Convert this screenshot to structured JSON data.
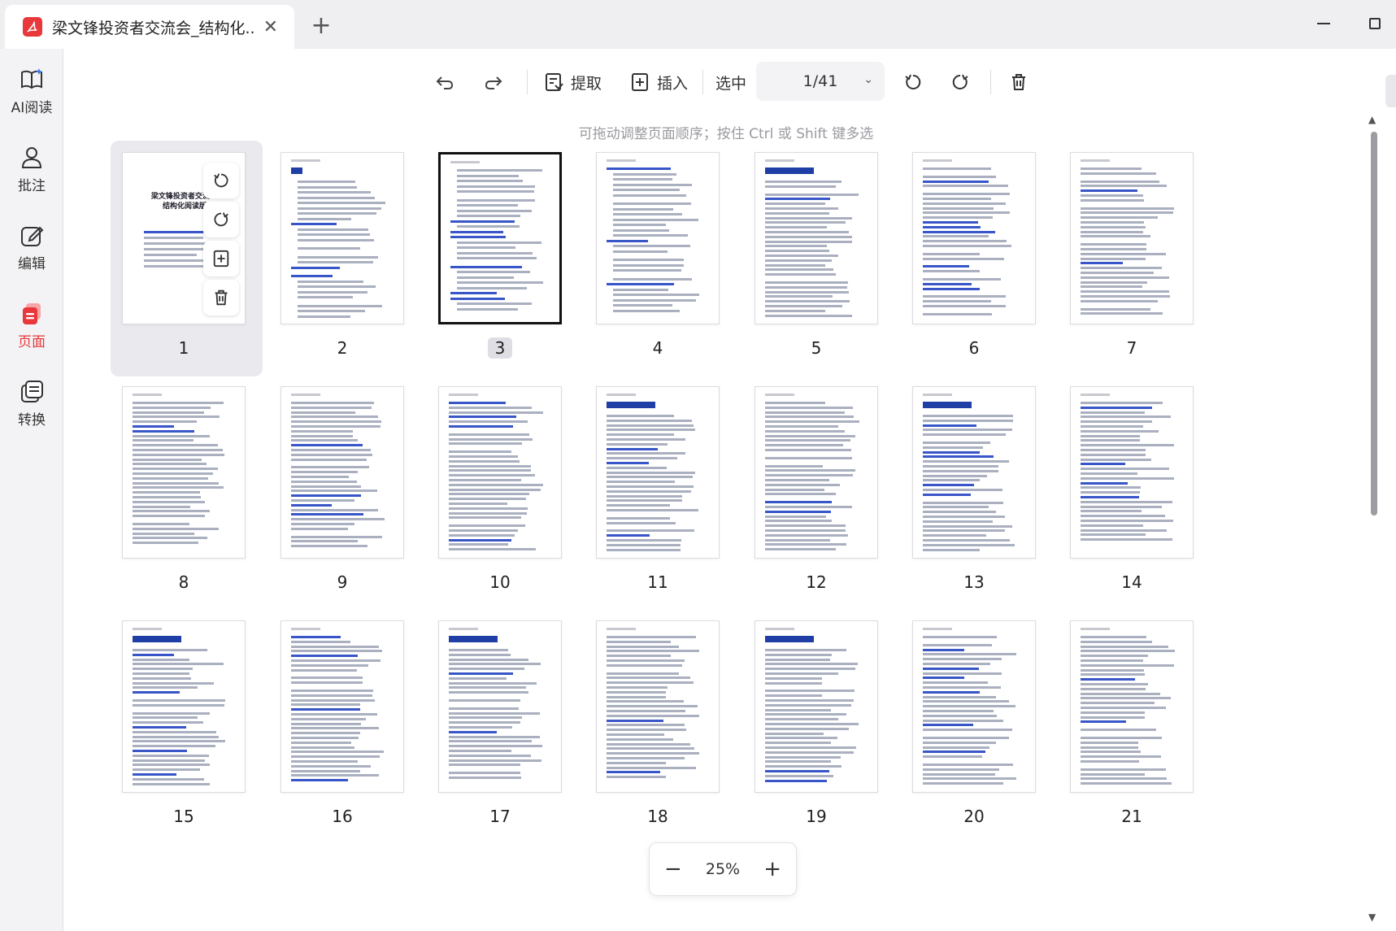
{
  "tab": {
    "title": "梁文锋投资者交流会_结构化...",
    "close": "✕",
    "new_tab": "+"
  },
  "sidebar": {
    "items": [
      {
        "label": "AI阅读",
        "icon": "book-ai-icon"
      },
      {
        "label": "批注",
        "icon": "annotate-icon"
      },
      {
        "label": "编辑",
        "icon": "edit-icon"
      },
      {
        "label": "页面",
        "icon": "pages-icon",
        "active": true
      },
      {
        "label": "转换",
        "icon": "convert-icon"
      }
    ]
  },
  "toolbar": {
    "extract": "提取",
    "insert": "插入",
    "select": "选中",
    "page_indicator": "1/41"
  },
  "hint": "可拖动调整页面顺序；按住 Ctrl 或 Shift 键多选",
  "pages": [
    "1",
    "2",
    "3",
    "4",
    "5",
    "6",
    "7",
    "8",
    "9",
    "10",
    "11",
    "12",
    "13",
    "14",
    "15",
    "16",
    "17",
    "18",
    "19",
    "20",
    "21"
  ],
  "cover": {
    "line1": "梁文锋投资者交流...",
    "line2": "结构化阅读版"
  },
  "zoom": {
    "minus": "−",
    "value": "25%",
    "plus": "+"
  },
  "state": {
    "selected_page": 1,
    "focused_page": 3
  },
  "colors": {
    "accent": "#e8383c",
    "heading_blue": "#1f3fa6"
  }
}
